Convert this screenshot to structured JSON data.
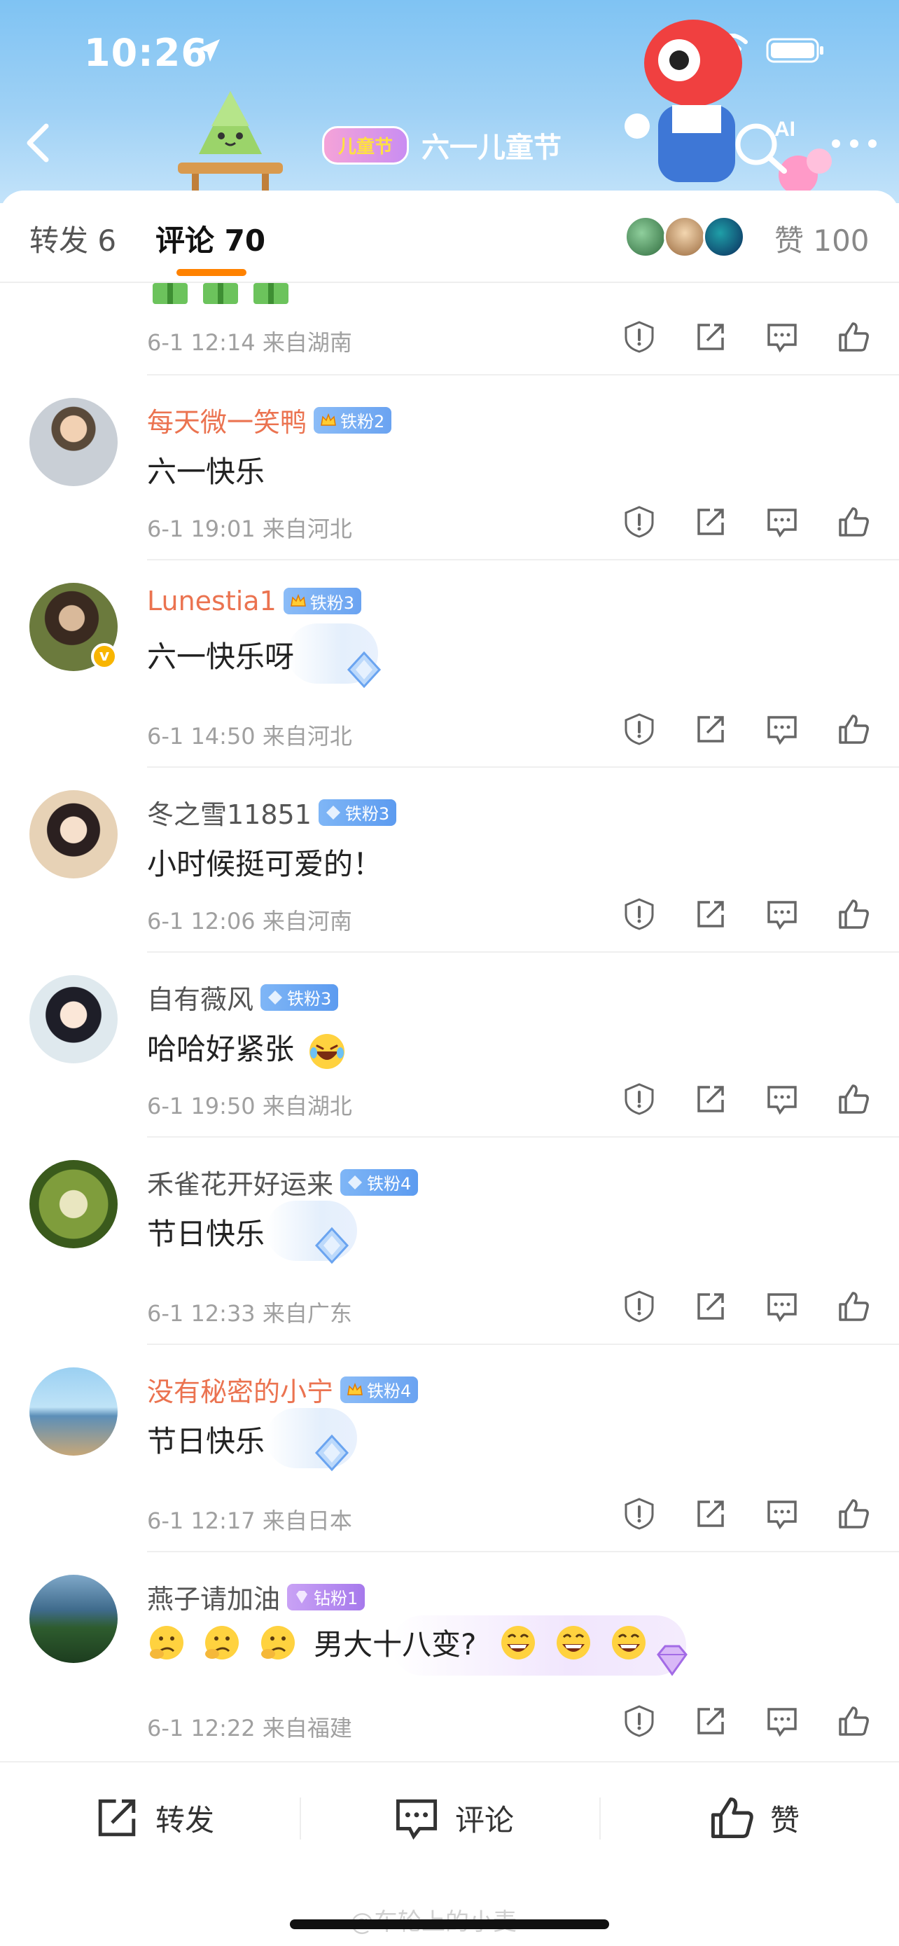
{
  "status_bar": {
    "time": "10:26"
  },
  "header": {
    "badge": "儿童节",
    "title": "六一儿童节",
    "search_label": "AI"
  },
  "tabs": {
    "repost": "转发 6",
    "comments": "评论 70",
    "likes": "赞 100"
  },
  "first_comment_meta": "6-1 12:14  来自湖南",
  "comments": [
    {
      "user": "每天微一笑鸭",
      "badge": "铁粉2",
      "text": "六一快乐",
      "meta": "6-1 19:01  来自河北"
    },
    {
      "user": "Lunestia1",
      "badge": "铁粉3",
      "text": "六一快乐呀",
      "meta": "6-1 14:50  来自河北"
    },
    {
      "user": "冬之雪11851",
      "badge": "铁粉3",
      "text": "小时候挺可爱的！",
      "meta": "6-1 12:06  来自河南"
    },
    {
      "user": "自有薇风",
      "badge": "铁粉3",
      "text": "哈哈好紧张",
      "meta": "6-1 19:50  来自湖北"
    },
    {
      "user": "禾雀花开好运来",
      "badge": "铁粉4",
      "text": "节日快乐",
      "meta": "6-1 12:33  来自广东"
    },
    {
      "user": "没有秘密的小宁",
      "badge": "铁粉4",
      "text": "节日快乐",
      "meta": "6-1 12:17  来自日本"
    },
    {
      "user": "燕子请加油",
      "badge": "钻粉1",
      "text": "男大十八变?",
      "meta": "6-1 12:22  来自福建"
    }
  ],
  "bottom_bar": {
    "repost": "转发",
    "comment": "评论",
    "like": "赞"
  },
  "watermark": "@车轮上的小麦",
  "colors": {
    "accent": "#ff8200",
    "orange_name": "#eb7350",
    "header_sky": "#7fc3f3",
    "meta_gray": "#a0a0a0"
  }
}
